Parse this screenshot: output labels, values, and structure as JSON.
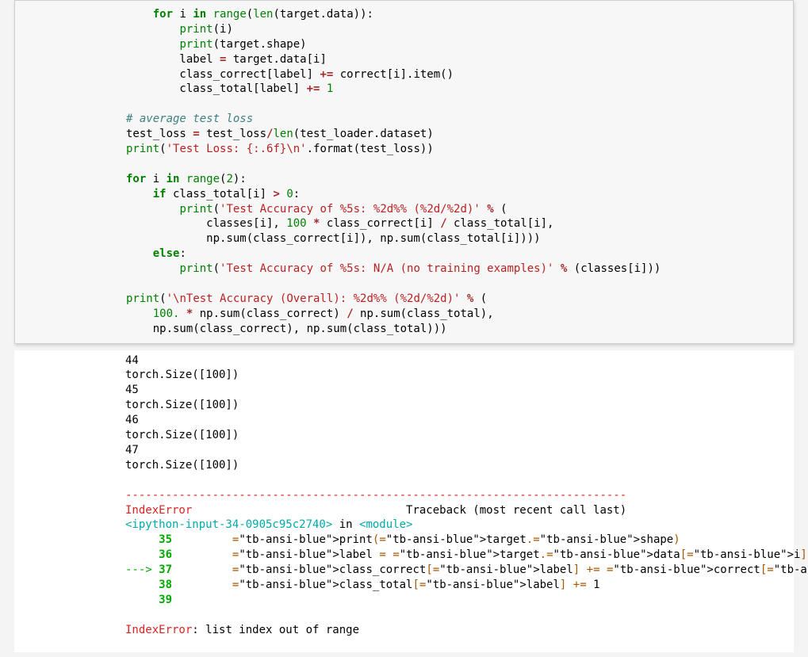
{
  "code": {
    "l1": "    for i in range(len(target.data)):",
    "l1_tok": {
      "for": "for",
      "i": "i",
      "in": "in",
      "range": "range",
      "len": "len",
      "rest": "(target.data)):",
      "open": "(",
      "close": ")):"
    },
    "l2": "        print(i)",
    "l3": "        print(target.shape)",
    "l4": "        label = target.data[i]",
    "l5": "        class_correct[label] += correct[i].item()",
    "l6": "        class_total[label] += 1",
    "l7": "",
    "l8": "# average test loss",
    "l9": "test_loss = test_loss/len(test_loader.dataset)",
    "l10": "print('Test Loss: {:.6f}\\n'.format(test_loss))",
    "l11": "",
    "l12": "for i in range(2):",
    "l13": "    if class_total[i] > 0:",
    "l14": "        print('Test Accuracy of %5s: %2d%% (%2d/%2d)' % (",
    "l15": "            classes[i], 100 * class_correct[i] / class_total[i],",
    "l16": "            np.sum(class_correct[i]), np.sum(class_total[i])))",
    "l17": "    else:",
    "l18": "        print('Test Accuracy of %5s: N/A (no training examples)' % (classes[i]))",
    "l19": "",
    "l20": "print('\\nTest Accuracy (Overall): %2d%% (%2d/%2d)' % (",
    "l21": "    100. * np.sum(class_correct) / np.sum(class_total),",
    "l22": "    np.sum(class_correct), np.sum(class_total)))"
  },
  "output": {
    "pre": [
      "44",
      "torch.Size([100])",
      "45",
      "torch.Size([100])",
      "46",
      "torch.Size([100])",
      "47",
      "torch.Size([100])"
    ],
    "dash_line": "---------------------------------------------------------------------------",
    "err_name": "IndexError",
    "tb_label": "Traceback (most recent call last)",
    "err_spacing": "                                ",
    "tb_file": "<ipython-input-34-0905c95c2740>",
    "tb_in": " in ",
    "tb_module": "<module>",
    "tb_lines": [
      {
        "ln": "     35",
        "txt": "         print(target.shape)"
      },
      {
        "ln": "     36",
        "txt": "         label = target.data[i]"
      },
      {
        "arrow": "---> ",
        "ln": "37",
        "txt": "         class_correct[label] += correct[i].item()"
      },
      {
        "ln": "     38",
        "txt": "         class_total[label] += 1"
      },
      {
        "ln": "     39",
        "txt": ""
      }
    ],
    "final_err_name": "IndexError",
    "final_err_sep": ": ",
    "final_err_msg": "list index out of range"
  }
}
